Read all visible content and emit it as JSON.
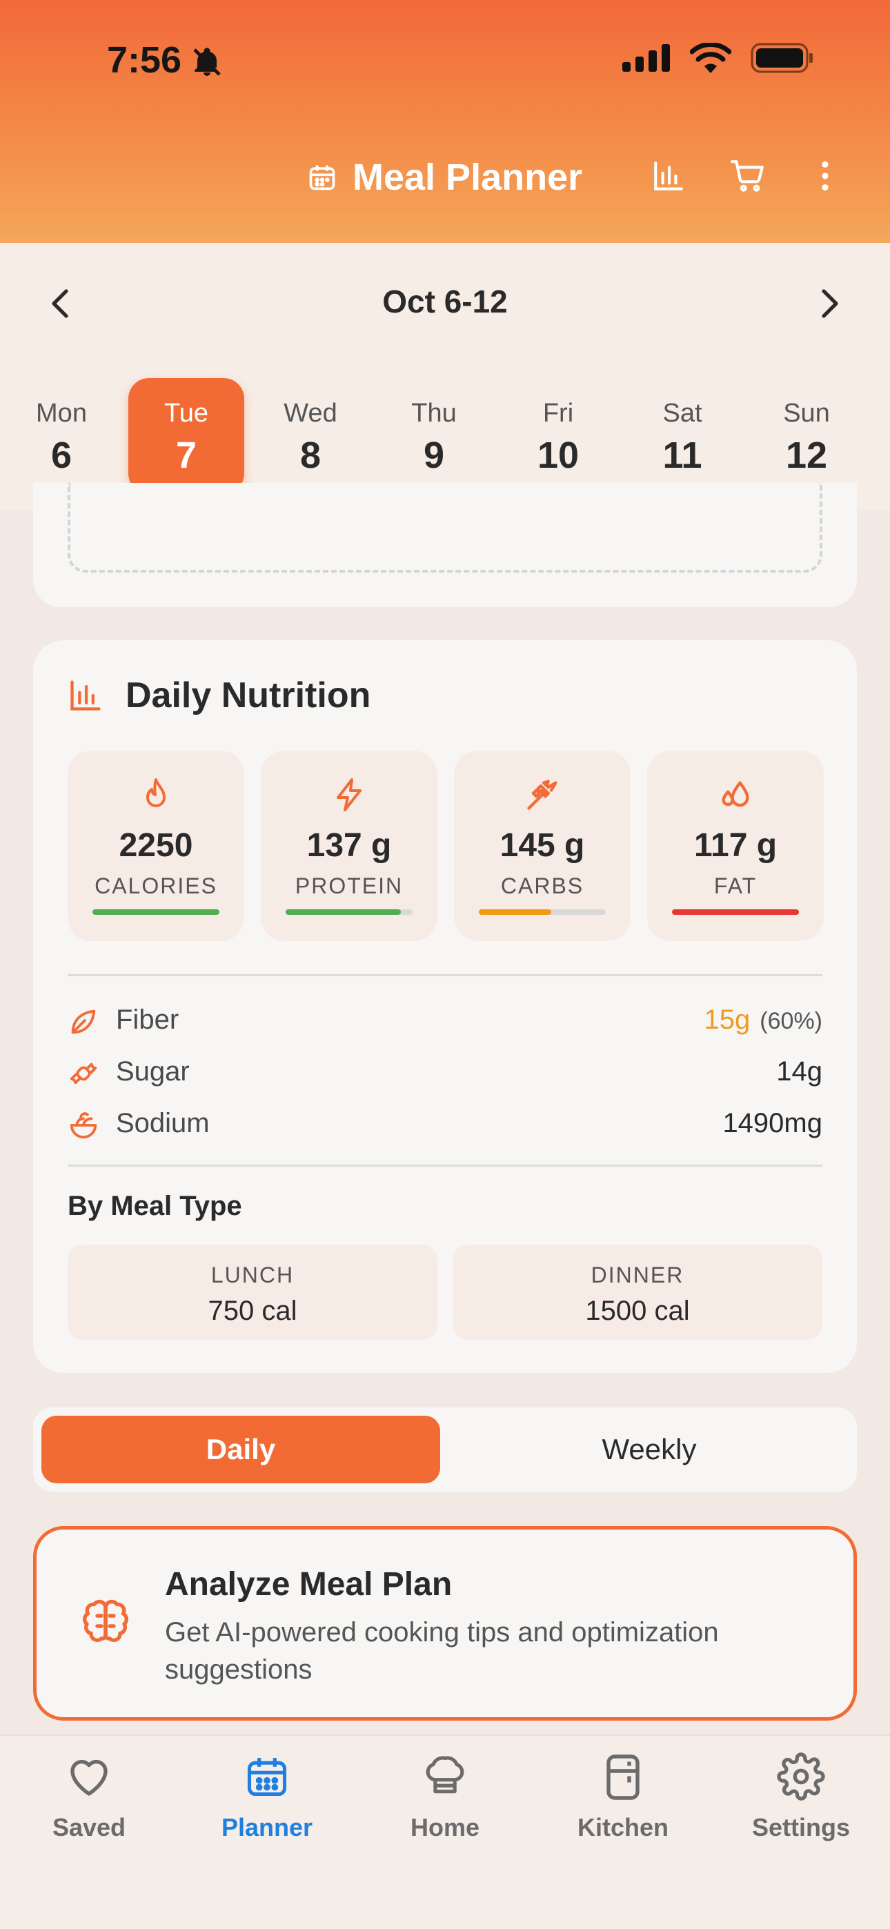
{
  "status_bar": {
    "time": "7:56"
  },
  "header": {
    "title": "Meal Planner"
  },
  "week": {
    "range": "Oct 6-12",
    "days": [
      {
        "name": "Mon",
        "num": "6"
      },
      {
        "name": "Tue",
        "num": "7",
        "selected": true
      },
      {
        "name": "Wed",
        "num": "8"
      },
      {
        "name": "Thu",
        "num": "9"
      },
      {
        "name": "Fri",
        "num": "10"
      },
      {
        "name": "Sat",
        "num": "11"
      },
      {
        "name": "Sun",
        "num": "12"
      }
    ]
  },
  "nutrition": {
    "title": "Daily Nutrition",
    "macros": [
      {
        "value": "2250",
        "label": "CALORIES",
        "icon": "flame-icon",
        "progress": 1.0,
        "color": "#4caf50"
      },
      {
        "value": "137 g",
        "label": "PROTEIN",
        "icon": "lightning-icon",
        "progress": 0.91,
        "color": "#4caf50"
      },
      {
        "value": "145 g",
        "label": "CARBS",
        "icon": "wheat-icon",
        "progress": 0.57,
        "color": "#f39c12"
      },
      {
        "value": "117 g",
        "label": "FAT",
        "icon": "droplets-icon",
        "progress": 1.0,
        "color": "#e53935"
      }
    ],
    "micros": {
      "fiber": {
        "name": "Fiber",
        "value": "15g",
        "pct": "(60%)"
      },
      "sugar": {
        "name": "Sugar",
        "value": "14g"
      },
      "sodium": {
        "name": "Sodium",
        "value": "1490mg"
      }
    },
    "by_meal_title": "By Meal Type",
    "by_meal": [
      {
        "label": "LUNCH",
        "value": "750 cal"
      },
      {
        "label": "DINNER",
        "value": "1500 cal"
      }
    ]
  },
  "toggle": {
    "daily": "Daily",
    "weekly": "Weekly"
  },
  "analyze": {
    "title": "Analyze Meal Plan",
    "subtitle": "Get AI-powered cooking tips and optimization suggestions"
  },
  "tabs": [
    {
      "label": "Saved",
      "icon": "heart-icon"
    },
    {
      "label": "Planner",
      "icon": "calendar-icon",
      "active": true
    },
    {
      "label": "Home",
      "icon": "chef-hat-icon"
    },
    {
      "label": "Kitchen",
      "icon": "fridge-icon"
    },
    {
      "label": "Settings",
      "icon": "gear-icon"
    }
  ],
  "colors": {
    "accent": "#f26b35",
    "tab_active": "#1f7fe0",
    "fiber_value": "#f09a22"
  }
}
